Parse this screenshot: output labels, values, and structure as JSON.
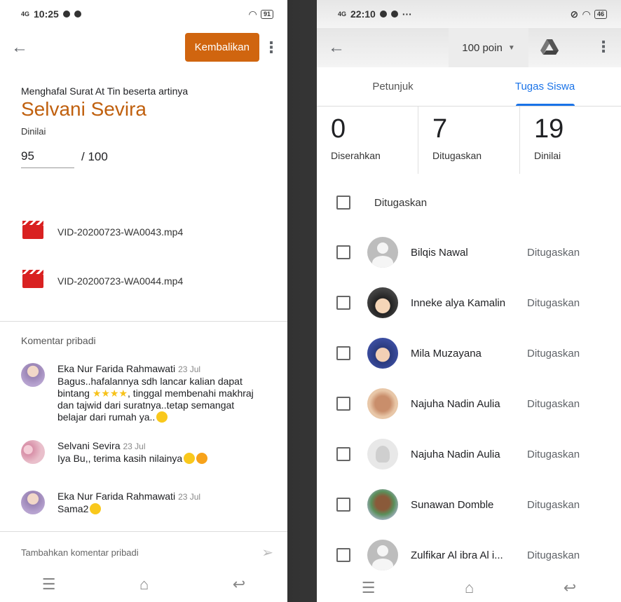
{
  "left": {
    "statusbar": {
      "network": "4G",
      "time": "10:25",
      "battery": "91"
    },
    "return_button": "Kembalikan",
    "assignment_title": "Menghafal Surat At Tin beserta artinya",
    "student_name": "Selvani Sevira",
    "grade_status": "Dinilai",
    "grade_value": "95",
    "grade_max": "/ 100",
    "attachments": [
      {
        "name": "VID-20200723-WA0043.mp4",
        "icon": "video-icon"
      },
      {
        "name": "VID-20200723-WA0044.mp4",
        "icon": "video-icon"
      }
    ],
    "comments_header": "Komentar pribadi",
    "comments": [
      {
        "author": "Eka Nur Farida Rahmawati",
        "date": "23 Jul",
        "text_1": "Bagus..hafalannya sdh lancar kalian dapat bintang ",
        "stars": "★★★★",
        "text_2": ", tinggal membenahi makhraj dan tajwid dari suratnya..tetap semangat belajar dari rumah ya.."
      },
      {
        "author": "Selvani Sevira",
        "date": "23 Jul",
        "text": "Iya Bu,, terima kasih nilainya"
      },
      {
        "author": "Eka Nur Farida Rahmawati",
        "date": "23 Jul",
        "text": "Sama2"
      }
    ],
    "add_comment_placeholder": "Tambahkan komentar pribadi"
  },
  "right": {
    "statusbar": {
      "network": "4G",
      "time": "22:10",
      "extra": "···",
      "battery": "46"
    },
    "points": "100 poin",
    "tabs": [
      {
        "label": "Petunjuk"
      },
      {
        "label": "Tugas Siswa"
      }
    ],
    "stats": [
      {
        "count": "0",
        "label": "Diserahkan"
      },
      {
        "count": "7",
        "label": "Ditugaskan"
      },
      {
        "count": "19",
        "label": "Dinilai"
      }
    ],
    "list_header": "Ditugaskan",
    "students": [
      {
        "name": "Bilqis Nawal",
        "status": "Ditugaskan"
      },
      {
        "name": "Inneke alya Kamalin",
        "status": "Ditugaskan"
      },
      {
        "name": "Mila Muzayana",
        "status": "Ditugaskan"
      },
      {
        "name": "Najuha Nadin Aulia",
        "status": "Ditugaskan"
      },
      {
        "name": "Najuha Nadin Aulia",
        "status": "Ditugaskan"
      },
      {
        "name": "Sunawan Domble",
        "status": "Ditugaskan"
      },
      {
        "name": "Zulfikar Al ibra Al i...",
        "status": "Ditugaskan"
      }
    ]
  },
  "colors": {
    "accent_orange": "#d0650f",
    "accent_blue": "#1a73e8"
  }
}
